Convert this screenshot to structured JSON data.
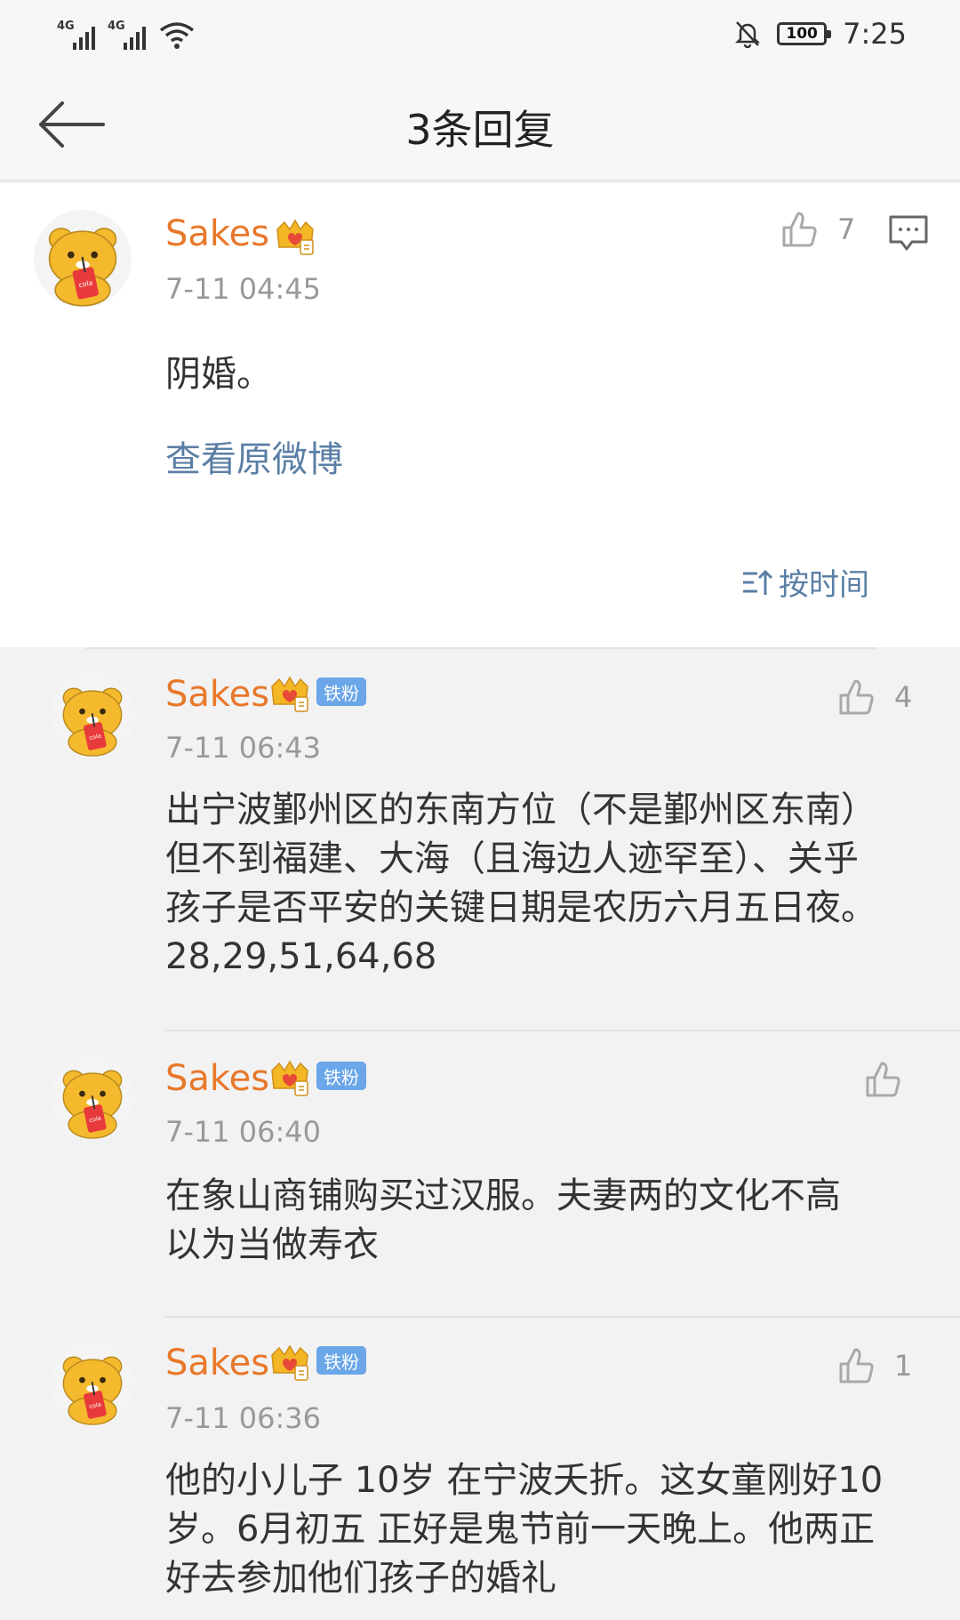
{
  "status_bar": {
    "signal1": "4G",
    "signal2": "4G",
    "battery": "100",
    "time": "7:25"
  },
  "nav": {
    "title": "3条回复"
  },
  "main_comment": {
    "username": "Sakes",
    "timestamp": "7-11 04:45",
    "likes": "7",
    "text": "阴婚。",
    "view_original": "查看原微博"
  },
  "sort": {
    "label": "按时间"
  },
  "replies": [
    {
      "username": "Sakes",
      "badge": "铁粉",
      "timestamp": "7-11 06:43",
      "likes": "4",
      "lines": [
        "出宁波鄞州区的东南方位（不是鄞州区东南）",
        "但不到福建、大海（且海边人迹罕至）、关乎",
        "孩子是否平安的关键日期是农历六月五日夜。",
        "28,29,51,64,68"
      ]
    },
    {
      "username": "Sakes",
      "badge": "铁粉",
      "timestamp": "7-11 06:40",
      "likes": "",
      "lines": [
        "在象山商铺购买过汉服。夫妻两的文化不高",
        "以为当做寿衣"
      ]
    },
    {
      "username": "Sakes",
      "badge": "铁粉",
      "timestamp": "7-11 06:36",
      "likes": "1",
      "lines": [
        "他的小儿子 10岁 在宁波夭折。这女童刚好10",
        "岁。6月初五 正好是鬼节前一天晚上。他两正",
        "好去参加他们孩子的婚礼"
      ]
    }
  ],
  "colors": {
    "username": "#e8782a",
    "link": "#5b7fa6",
    "badge": "#6aa6e8",
    "timestamp": "#999999"
  }
}
